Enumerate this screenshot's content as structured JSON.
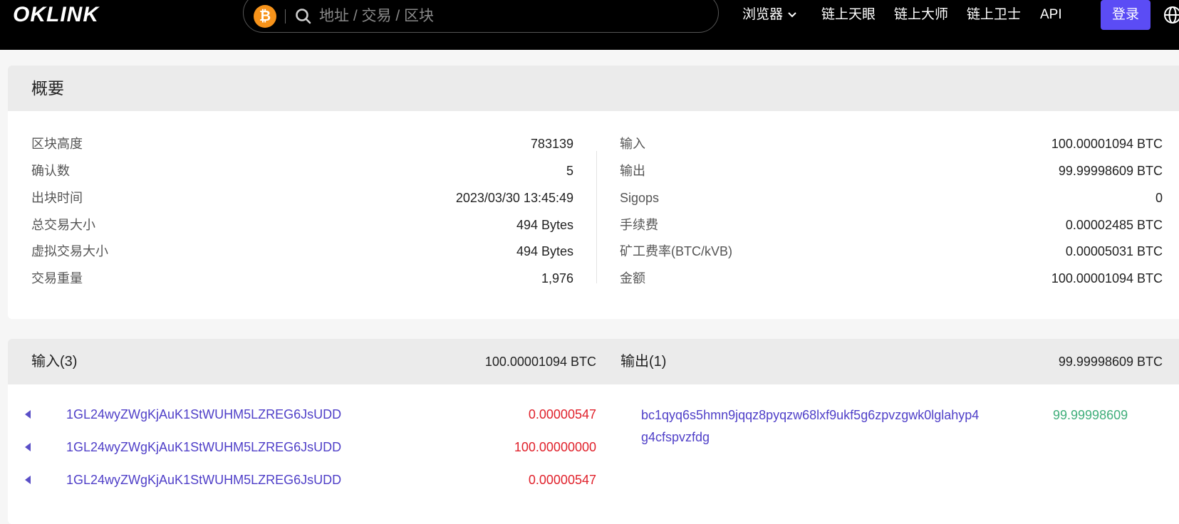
{
  "header": {
    "logo": "OKLINK",
    "coin_symbol": "₿",
    "search_placeholder": "地址 / 交易 / 区块",
    "nav": [
      "浏览器",
      "链上天眼",
      "链上大师",
      "链上卫士",
      "API"
    ],
    "login_label": "登录",
    "accent_color": "#5b4cf5",
    "coin_color": "#f7931a"
  },
  "overview": {
    "title": "概要",
    "left": [
      {
        "label": "区块高度",
        "value": "783139"
      },
      {
        "label": "确认数",
        "value": "5"
      },
      {
        "label": "出块时间",
        "value": "2023/03/30 13:45:49"
      },
      {
        "label": "总交易大小",
        "value": "494 Bytes"
      },
      {
        "label": "虚拟交易大小",
        "value": "494 Bytes"
      },
      {
        "label": "交易重量",
        "value": "1,976"
      }
    ],
    "right": [
      {
        "label": "输入",
        "value": "100.00001094 BTC"
      },
      {
        "label": "输出",
        "value": "99.99998609 BTC"
      },
      {
        "label": "Sigops",
        "value": "0"
      },
      {
        "label": "手续费",
        "value": "0.00002485 BTC"
      },
      {
        "label": "矿工费率(BTC/kVB)",
        "value": "0.00005031 BTC"
      },
      {
        "label": "金额",
        "value": "100.00001094 BTC"
      }
    ]
  },
  "io": {
    "inputs_label": "输入(3)",
    "inputs_total": "100.00001094 BTC",
    "outputs_label": "输出(1)",
    "outputs_total": "99.99998609 BTC",
    "inputs": [
      {
        "address": "1GL24wyZWgKjAuK1StWUHM5LZREG6JsUDD",
        "amount": "0.00000547"
      },
      {
        "address": "1GL24wyZWgKjAuK1StWUHM5LZREG6JsUDD",
        "amount": "100.00000000"
      },
      {
        "address": "1GL24wyZWgKjAuK1StWUHM5LZREG6JsUDD",
        "amount": "0.00000547"
      }
    ],
    "outputs": [
      {
        "address": "bc1qyq6s5hmn9jqqz8pyqzw68lxf9ukf5g6zpvzgwk0lglahyp4g4cfspvzfdg",
        "amount": "99.99998609"
      }
    ],
    "input_amount_color": "#e0212b",
    "output_amount_color": "#3fae7a",
    "link_color": "#4f3fc8"
  }
}
